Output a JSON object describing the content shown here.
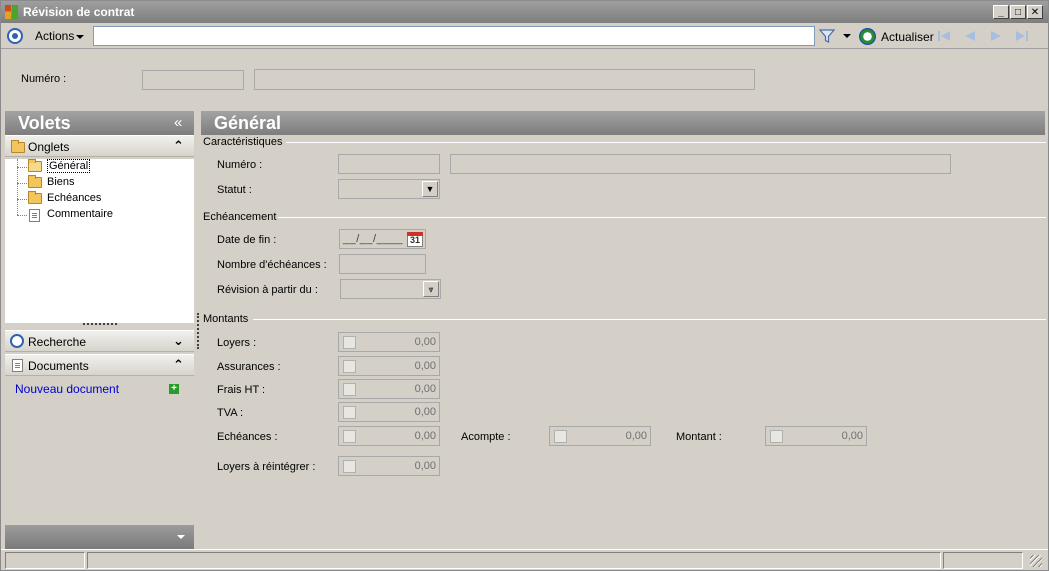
{
  "window": {
    "title": "Révision de contrat",
    "controls": {
      "minimize": "_",
      "maximize": "□",
      "close": "✕"
    }
  },
  "toolbar": {
    "actions_label": "Actions",
    "search_value": "",
    "refresh_label": "Actualiser",
    "icons": [
      "filter-icon",
      "refresh-icon",
      "first-record-icon",
      "previous-record-icon",
      "next-record-icon",
      "last-record-icon"
    ]
  },
  "header": {
    "numero_label": "Numéro :",
    "numero_code": "",
    "numero_name": ""
  },
  "sidebar": {
    "title": "Volets",
    "collapse_glyph": "«",
    "onglets": {
      "label": "Onglets",
      "items": [
        {
          "label": "Général",
          "icon": "open-folder-icon",
          "selected": true
        },
        {
          "label": "Biens",
          "icon": "folder-icon",
          "selected": false
        },
        {
          "label": "Echéances",
          "icon": "folder-icon",
          "selected": false
        },
        {
          "label": "Commentaire",
          "icon": "document-icon",
          "selected": false
        }
      ]
    },
    "recherche": {
      "label": "Recherche"
    },
    "documents": {
      "label": "Documents",
      "new_document_label": "Nouveau document"
    }
  },
  "main": {
    "title": "Général",
    "caracteristiques": {
      "title": "Caractéristiques",
      "numero_label": "Numéro :",
      "numero_code": "",
      "numero_name": "",
      "statut_label": "Statut :",
      "statut_value": ""
    },
    "echeancement": {
      "title": "Echéancement",
      "date_fin_label": "Date de fin :",
      "date_fin_value": "__/__/____",
      "calendar_day": "31",
      "nb_echeances_label": "Nombre d'échéances :",
      "nb_echeances_value": "",
      "revision_label": "Révision à partir du :",
      "revision_value": ""
    },
    "montants": {
      "title": "Montants",
      "loyers_label": "Loyers :",
      "loyers_value": "0,00",
      "assurances_label": "Assurances :",
      "assurances_value": "0,00",
      "frais_label": "Frais HT :",
      "frais_value": "0,00",
      "tva_label": "TVA :",
      "tva_value": "0,00",
      "echeances_label": "Echéances :",
      "echeances_value": "0,00",
      "acompte_label": "Acompte :",
      "acompte_value": "0,00",
      "montant_label": "Montant :",
      "montant_value": "0,00",
      "loyers_reint_label": "Loyers à réintégrer :",
      "loyers_reint_value": "0,00"
    }
  },
  "colors": {
    "window_bg": "#d4d0c8",
    "header_gradient_top": "#a3a3a3",
    "header_gradient_bottom": "#7d7d7d",
    "link": "#0000cc"
  }
}
